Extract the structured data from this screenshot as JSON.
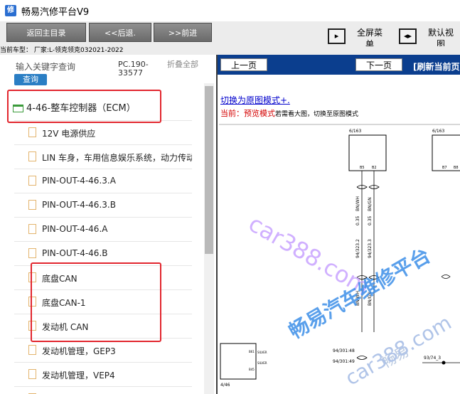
{
  "window": {
    "title": "畅易汽修平台V9",
    "icon": "app-logo-icon"
  },
  "toolbar": {
    "back_main": "返回主目录",
    "back": "<<后退.",
    "forward": ">>前进",
    "fullscreen_label": "全屏菜单",
    "default_view_label": "默认视图"
  },
  "car_info": "当前车型： 厂家:L-领克领克032021-2022",
  "left": {
    "search_label": "输入关键字查询",
    "search_button": "查询",
    "pc_code": "PC.190-33577",
    "collapse_all": "折叠全部",
    "root": "4-46-整车控制器（ECM）",
    "items": [
      "12V 电源供应",
      "LIN 车身，车用信息娱乐系统，动力传动",
      "PIN-OUT-4-46.3.A",
      "PIN-OUT-4-46.3.B",
      "PIN-OUT-4-46.A",
      "PIN-OUT-4-46.B",
      "底盘CAN",
      "底盘CAN-1",
      "发动机 CAN",
      "发动机管理，GEP3",
      "发动机管理，VEP4",
      ""
    ]
  },
  "right": {
    "prev_page": "上一页",
    "next_page": "下一页",
    "refresh": "[刷新当前页",
    "switch_link": "切换为原图模式+.",
    "current_prefix": "当前：",
    "current_mode": "预览模式",
    "current_hint": "若需看大图，切换至原图模式"
  },
  "diagram": {
    "connector_a": "6/163",
    "connector_b": "6/163",
    "pin_b5": "B5",
    "pin_b2": "B2",
    "pin_b7": "B7",
    "pin_b8": "B8",
    "wire1_gauge": "0.35",
    "wire1_color": "BN/WH",
    "wire2_gauge": "0.35",
    "wire2_color": "BN/GN",
    "splice1": "94/323.2",
    "splice2": "94/323.3",
    "wire3_color": "BN/WH",
    "wire4_color": "BN/GN",
    "node1": "94/301:48",
    "node2": "94/301:49",
    "node3": "93/74_3",
    "box_label": "4/46",
    "pin_b61": "B61",
    "pin_b45": "B45",
    "silver1": "SILVER",
    "silver2": "SILVER"
  },
  "watermarks": {
    "site": "car388.com",
    "platform": "畅易汽车维修平台",
    "brand": "畅易",
    "site2": "car388.com"
  },
  "colors": {
    "highlight_red": "#e2262e",
    "nav_blue": "#0b3e8e",
    "search_blue": "#2a7ec4",
    "folder_green": "#3a9a3a"
  }
}
